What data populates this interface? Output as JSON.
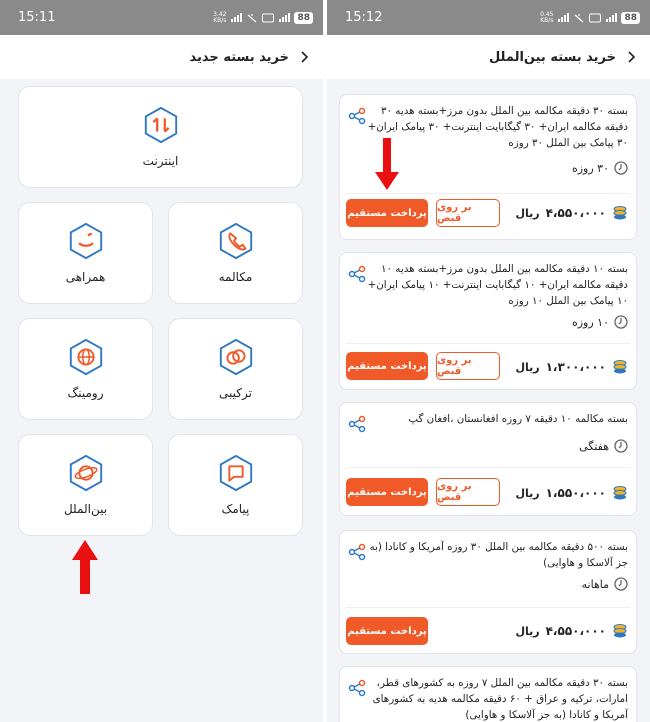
{
  "left_screen": {
    "status": {
      "time": "15:11",
      "speed": "3.42\nKB/s",
      "battery": "88"
    },
    "header": {
      "title": "خرید بسته جدید"
    },
    "tiles": [
      {
        "label": "اینترنت",
        "icon": "internet-arrows-icon"
      },
      {
        "label": "مکالمه",
        "icon": "phone-icon"
      },
      {
        "label": "همراهی",
        "icon": "companion-smile-icon"
      },
      {
        "label": "ترکیبی",
        "icon": "combo-rings-icon"
      },
      {
        "label": "رومینگ",
        "icon": "globe-icon"
      },
      {
        "label": "پیامک",
        "icon": "sms-bubble-icon"
      },
      {
        "label": "بین‌الملل",
        "icon": "planet-icon"
      }
    ]
  },
  "right_screen": {
    "status": {
      "time": "15:12",
      "speed": "0.45\nKB/s",
      "battery": "88"
    },
    "header": {
      "title": "خرید بسته بین‌الملل"
    },
    "buttons": {
      "direct": "پرداخت مستقیم",
      "receipt": "بر روی قبض"
    },
    "currency": "ریال",
    "cards": [
      {
        "desc": "بسته ۳۰ دقیقه مکالمه بین الملل بدون مرز+بسته هدیه ۳۰ دقیقه مکالمه ایران+ ۳۰ گیگابایت اینترنت+ ۳۰ پیامک ایران+ ۳۰ پیامک بین الملل ۳۰ روزه",
        "duration": "۳۰ روزه",
        "price": "۴،۵۵۰،۰۰۰"
      },
      {
        "desc": "بسته ۱۰ دقیقه مکالمه بین الملل بدون مرز+بسته هدیه ۱۰ دقیقه مکالمه ایران+ ۱۰ گیگابایت اینترنت+ ۱۰ پیامک ایران+ ۱۰ پیامک بین الملل ۱۰ روزه",
        "duration": "۱۰ روزه",
        "price": "۱،۳۰۰،۰۰۰"
      },
      {
        "desc": "بسته مکالمه ۱۰ دقیقه ۷ روزه افغانستان ،افغان گپ",
        "duration": "هفتگی",
        "price": "۱،۵۵۰،۰۰۰"
      },
      {
        "desc": "بسته ۵۰۰ دقیقه مکالمه بین الملل ۳۰ روزه آمریکا و کانادا (به جز آلاسکا و هاوایی)",
        "duration": "ماهانه",
        "price": "۴،۵۵۰،۰۰۰"
      },
      {
        "desc": "بسته ۳۰ دقیقه مکالمه بین الملل ۷ روزه به کشورهای قطر، امارات، ترکیه و عراق + ۶۰ دقیقه مکالمه هدیه به کشورهای آمریکا و کانادا (به جز آلاسکا و هاوایی)"
      }
    ]
  },
  "colors": {
    "accent": "#ef5a28",
    "icon_blue": "#2f78c4",
    "arrow_red": "#e81010"
  }
}
